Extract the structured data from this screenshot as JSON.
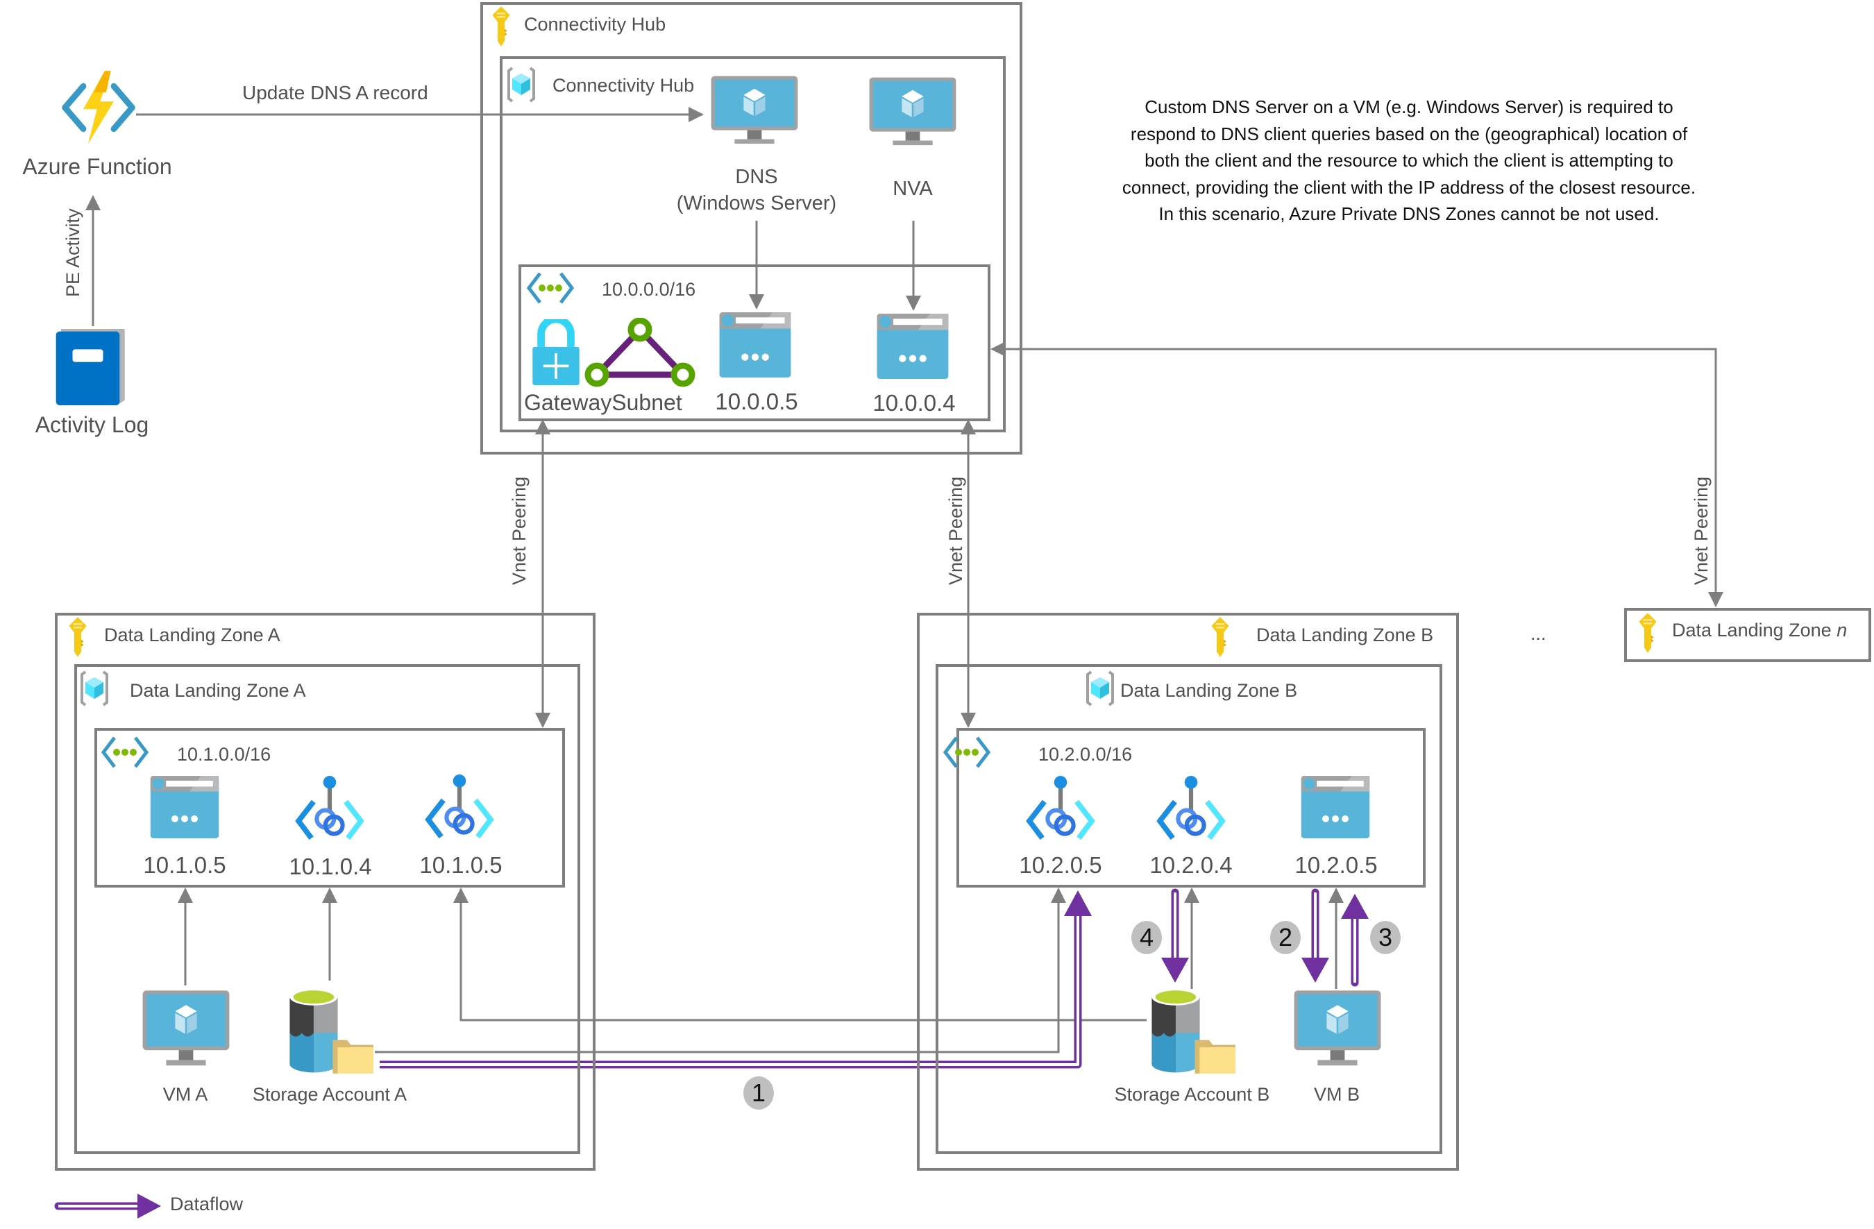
{
  "external": {
    "azure_function": "Azure Function",
    "activity_log": "Activity Log",
    "pe_activity": "PE Activity",
    "update_dns": "Update DNS A record"
  },
  "note": {
    "lines": [
      "Custom DNS Server on a VM (e.g. Windows Server) is required to",
      "respond to DNS client queries based on the (geographical) location of",
      "both the client and the resource to which the client is attempting to",
      "connect, providing the client with the IP address of the closest resource.",
      "In this scenario, Azure Private DNS Zones cannot be  not used."
    ]
  },
  "hub": {
    "subscription": "Connectivity Hub",
    "resource_group": "Connectivity Hub",
    "vnet_cidr": "10.0.0.0/16",
    "dns_label_1": "DNS",
    "dns_label_2": "(Windows Server)",
    "nva_label": "NVA",
    "gateway_subnet": "GatewaySubnet",
    "dns_nic_ip": "10.0.0.5",
    "nva_nic_ip": "10.0.0.4"
  },
  "peering": {
    "label_a": "Vnet Peering",
    "label_b": "Vnet Peering",
    "label_n": "Vnet Peering"
  },
  "zone_a": {
    "subscription": "Data Landing Zone A",
    "resource_group": "Data Landing Zone A",
    "vnet_cidr": "10.1.0.0/16",
    "nic_ip": "10.1.0.5",
    "pe_1_ip": "10.1.0.4",
    "pe_2_ip": "10.1.0.5",
    "vm": "VM A",
    "storage": "Storage Account A"
  },
  "zone_b": {
    "subscription": "Data Landing Zone B",
    "resource_group": "Data Landing Zone B",
    "vnet_cidr": "10.2.0.0/16",
    "pe_1_ip": "10.2.0.5",
    "pe_2_ip": "10.2.0.4",
    "nic_ip": "10.2.0.5",
    "vm": "VM B",
    "storage": "Storage Account B"
  },
  "zone_n": {
    "prefix": "Data Landing Zone ",
    "suffix": "n"
  },
  "ellipsis": "...",
  "steps": [
    "1",
    "2",
    "3",
    "4"
  ],
  "legend": {
    "dataflow": "Dataflow"
  },
  "colors": {
    "border": "#7f7f7f",
    "dataflow": "#7030a0",
    "azure_blue": "#59b4d9",
    "key_yellow": "#f6c916",
    "vnet_green": "#7fba00"
  }
}
